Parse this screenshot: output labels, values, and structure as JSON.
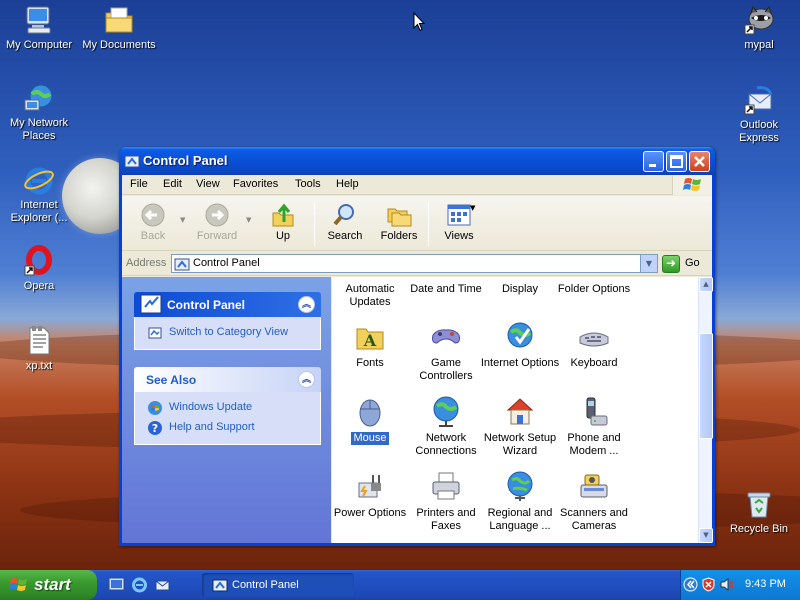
{
  "desktop": {
    "icons": [
      {
        "label": "My Computer",
        "icon": "my-computer-icon"
      },
      {
        "label": "My Documents",
        "icon": "my-documents-icon"
      },
      {
        "label": "My Network Places",
        "icon": "network-places-icon"
      },
      {
        "label": "Internet Explorer (...",
        "icon": "internet-explorer-icon"
      },
      {
        "label": "Opera",
        "icon": "opera-icon"
      },
      {
        "label": "xp.txt",
        "icon": "text-file-icon"
      },
      {
        "label": "mypal",
        "icon": "mypal-icon"
      },
      {
        "label": "Outlook Express",
        "icon": "outlook-express-icon"
      },
      {
        "label": "Recycle Bin",
        "icon": "recycle-bin-icon"
      }
    ]
  },
  "window": {
    "title": "Control Panel",
    "menu": [
      "File",
      "Edit",
      "View",
      "Favorites",
      "Tools",
      "Help"
    ],
    "toolbar": {
      "back": "Back",
      "forward": "Forward",
      "up": "Up",
      "search": "Search",
      "folders": "Folders",
      "views": "Views"
    },
    "address": {
      "label": "Address",
      "value": "Control Panel",
      "go": "Go"
    },
    "taskpane": {
      "control_panel": {
        "title": "Control Panel",
        "link": "Switch to Category View"
      },
      "see_also": {
        "title": "See Also",
        "links": [
          "Windows Update",
          "Help and Support"
        ]
      }
    },
    "items": [
      {
        "label": "Automatic Updates",
        "icon": "automatic-updates-icon"
      },
      {
        "label": "Date and Time",
        "icon": "date-time-icon"
      },
      {
        "label": "Display",
        "icon": "display-icon"
      },
      {
        "label": "Folder Options",
        "icon": "folder-options-icon"
      },
      {
        "label": "Fonts",
        "icon": "fonts-icon"
      },
      {
        "label": "Game Controllers",
        "icon": "game-controllers-icon"
      },
      {
        "label": "Internet Options",
        "icon": "internet-options-icon"
      },
      {
        "label": "Keyboard",
        "icon": "keyboard-icon"
      },
      {
        "label": "Mouse",
        "icon": "mouse-icon",
        "selected": true
      },
      {
        "label": "Network Connections",
        "icon": "network-connections-icon"
      },
      {
        "label": "Network Setup Wizard",
        "icon": "network-setup-wizard-icon"
      },
      {
        "label": "Phone and Modem ...",
        "icon": "phone-modem-icon"
      },
      {
        "label": "Power Options",
        "icon": "power-options-icon"
      },
      {
        "label": "Printers and Faxes",
        "icon": "printers-faxes-icon"
      },
      {
        "label": "Regional and Language ...",
        "icon": "regional-language-icon"
      },
      {
        "label": "Scanners and Cameras",
        "icon": "scanners-cameras-icon"
      }
    ]
  },
  "taskbar": {
    "start": "start",
    "task_button": "Control Panel",
    "clock": "9:43 PM"
  },
  "colors": {
    "titlebar_blue": "#0a4fd6",
    "taskbar_blue": "#1f4fc0",
    "start_green": "#3a9a2f",
    "selection_blue": "#316ac5",
    "link_blue": "#215dc6"
  }
}
